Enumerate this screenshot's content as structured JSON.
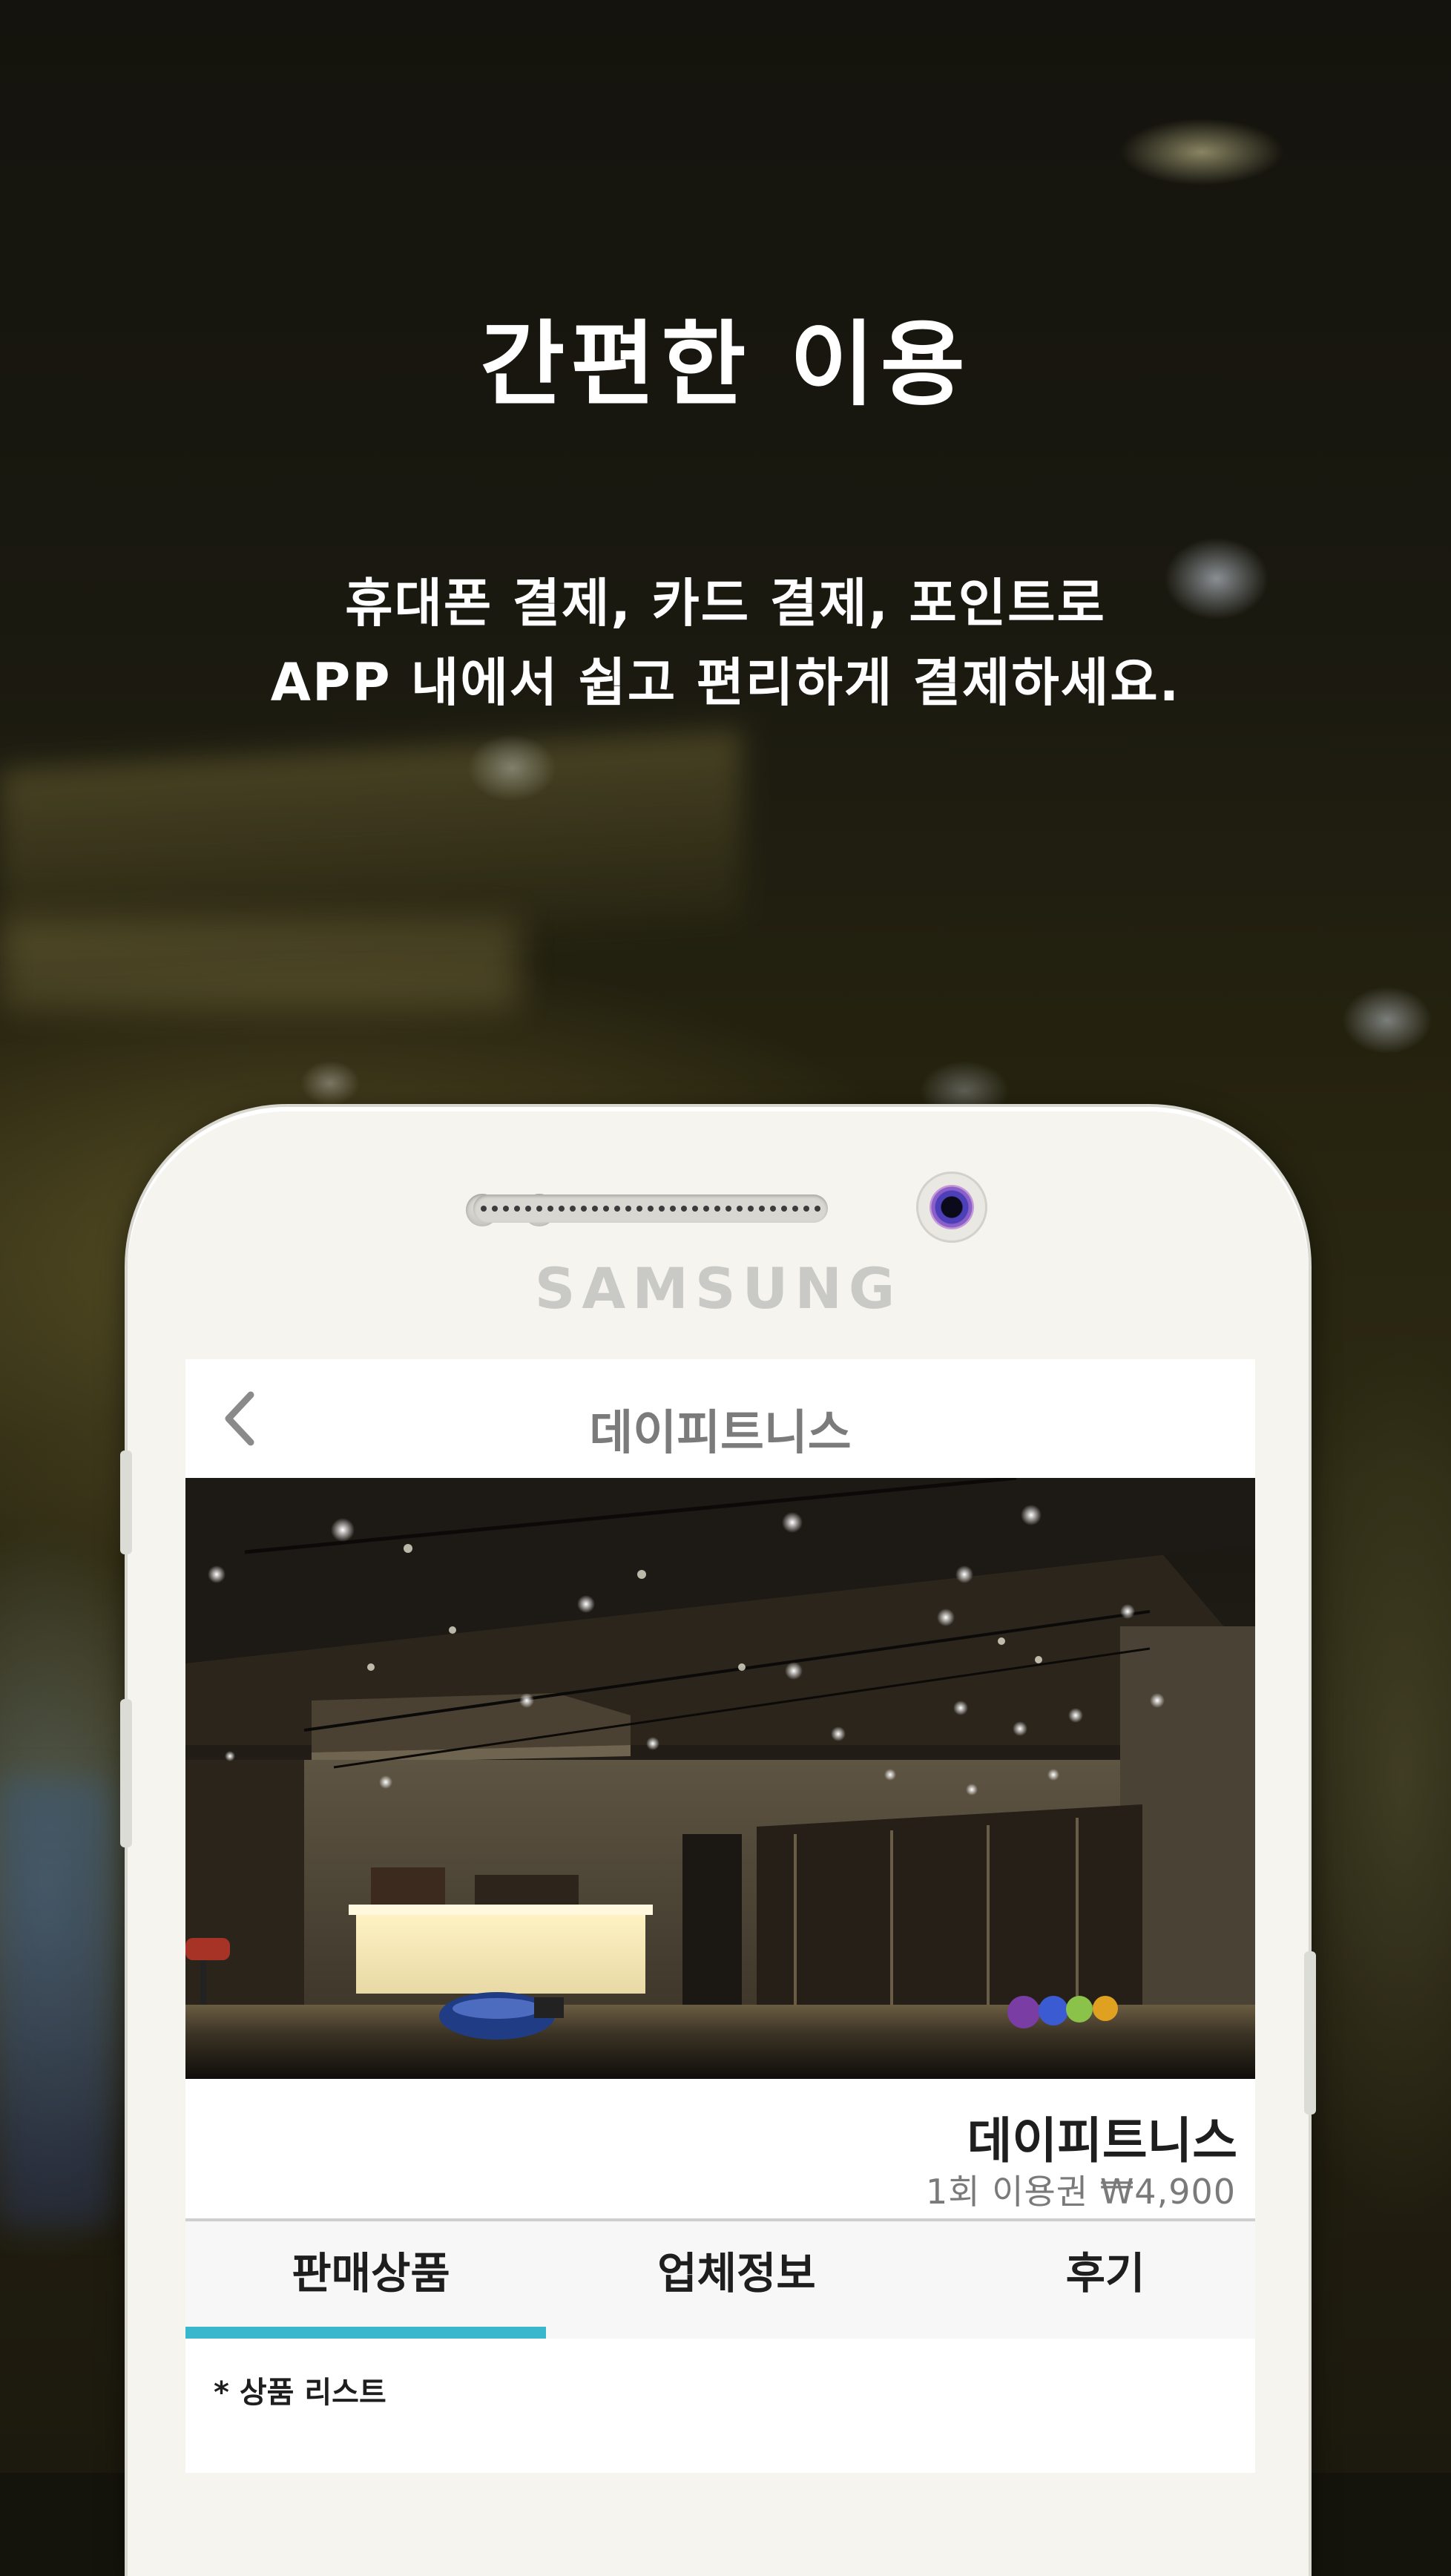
{
  "promo": {
    "headline": "간편한 이용",
    "subtitle_line1": "휴대폰 결제, 카드 결제, 포인트로",
    "subtitle_line2": "APP 내에서 쉽고 편리하게 결제하세요."
  },
  "device": {
    "brand": "SAMSUNG"
  },
  "app": {
    "title": "데이피트니스",
    "venue_name": "데이피트니스",
    "price_info": "1회 이용권 ₩4,900",
    "tabs": [
      {
        "label": "판매상품",
        "active": true
      },
      {
        "label": "업체정보",
        "active": false
      },
      {
        "label": "후기",
        "active": false
      }
    ],
    "list_label": "* 상품 리스트",
    "accent_color": "#39b7cd"
  }
}
